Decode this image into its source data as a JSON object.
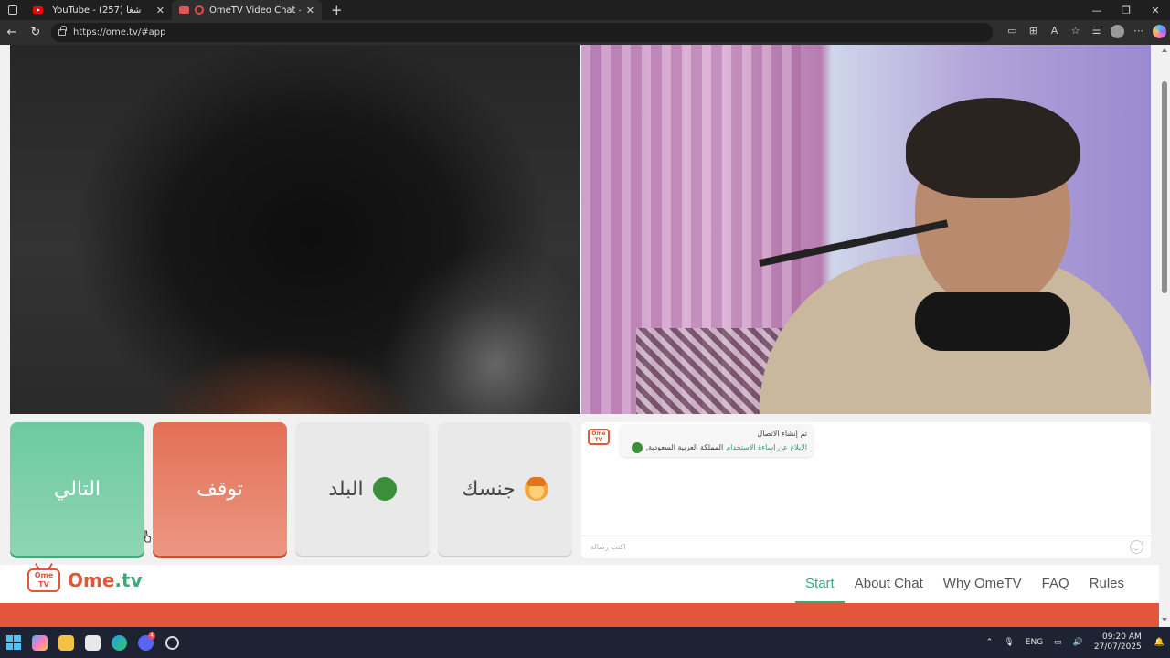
{
  "browser": {
    "tabs": [
      {
        "title": "YouTube - (257) شغا"
      },
      {
        "title": "OmeTV Video Chat — Ome"
      }
    ],
    "url": "https://ome.tv/#app"
  },
  "controls": {
    "next_label": "التالي",
    "stop_label": "توقف",
    "country_label": "البلد",
    "country_flag_text": "🇸🇦",
    "gender_label": "جنسك"
  },
  "chat": {
    "logo_text": "Ome TV",
    "status": "تم إنشاء الاتصال",
    "report_link": "الإبلاغ عن إساءة الاستخدام",
    "country": "المملكة العربية السعودية,",
    "input_placeholder": "اكتب رسالة"
  },
  "site": {
    "brand_tv_text": "Ome TV",
    "brand_name": "Ome",
    "brand_suffix": ".tv",
    "nav": [
      "Start",
      "About Chat",
      "Why OmeTV",
      "FAQ",
      "Rules"
    ],
    "active_nav": "Start"
  },
  "taskbar": {
    "lang": "ENG",
    "time": "09:20 AM",
    "date": "27/07/2025",
    "discord_badge": "4"
  },
  "colors": {
    "accent_green": "#3aaa7a",
    "accent_orange": "#e2563b"
  }
}
